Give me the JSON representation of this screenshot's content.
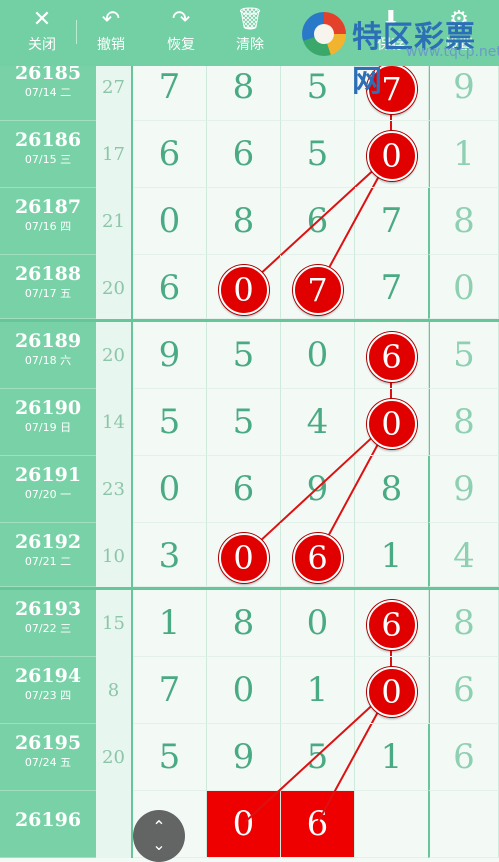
{
  "toolbar": {
    "close": {
      "icon": "close-icon",
      "label": "关闭"
    },
    "undo": {
      "icon": "undo-icon",
      "label": "撤销"
    },
    "redo": {
      "icon": "redo-icon",
      "label": "恢复"
    },
    "clear": {
      "icon": "trash-icon",
      "label": "清除"
    },
    "save": {
      "icon": "save-icon",
      "label": "保存"
    },
    "settings": {
      "icon": "settings-icon",
      "label": "设置"
    }
  },
  "watermark": {
    "name": "特区彩票网",
    "site": "www.tqcp.net"
  },
  "rows": [
    {
      "period": "26185",
      "date": "07/14 二",
      "sum": "27",
      "digits": [
        "7",
        "8",
        "5",
        "7",
        "9"
      ],
      "hit": 3
    },
    {
      "period": "26186",
      "date": "07/15 三",
      "sum": "17",
      "digits": [
        "6",
        "6",
        "5",
        "0",
        "1"
      ],
      "hit": 3
    },
    {
      "period": "26187",
      "date": "07/16 四",
      "sum": "21",
      "digits": [
        "0",
        "8",
        "6",
        "7",
        "8"
      ],
      "hit": -1
    },
    {
      "period": "26188",
      "date": "07/17 五",
      "sum": "20",
      "digits": [
        "6",
        "0",
        "7",
        "7",
        "0"
      ],
      "hit": [
        1,
        2
      ]
    },
    {
      "period": "26189",
      "date": "07/18 六",
      "sum": "20",
      "digits": [
        "9",
        "5",
        "0",
        "6",
        "5"
      ],
      "hit": 3
    },
    {
      "period": "26190",
      "date": "07/19 日",
      "sum": "14",
      "digits": [
        "5",
        "5",
        "4",
        "0",
        "8"
      ],
      "hit": 3
    },
    {
      "period": "26191",
      "date": "07/20 一",
      "sum": "23",
      "digits": [
        "0",
        "6",
        "9",
        "8",
        "9"
      ],
      "hit": -1
    },
    {
      "period": "26192",
      "date": "07/21 二",
      "sum": "10",
      "digits": [
        "3",
        "0",
        "6",
        "1",
        "4"
      ],
      "hit": [
        1,
        2
      ]
    },
    {
      "period": "26193",
      "date": "07/22 三",
      "sum": "15",
      "digits": [
        "1",
        "8",
        "0",
        "6",
        "8"
      ],
      "hit": 3
    },
    {
      "period": "26194",
      "date": "07/23 四",
      "sum": "8",
      "digits": [
        "7",
        "0",
        "1",
        "0",
        "6"
      ],
      "hit": 3
    },
    {
      "period": "26195",
      "date": "07/24 五",
      "sum": "20",
      "digits": [
        "5",
        "9",
        "5",
        "1",
        "6"
      ],
      "hit": -1
    },
    {
      "period": "26196",
      "date": "",
      "sum": "",
      "digits": [
        "",
        "0",
        "6",
        "",
        ""
      ],
      "hit": "box"
    }
  ],
  "float_button": {
    "icon": "expand-icon"
  }
}
